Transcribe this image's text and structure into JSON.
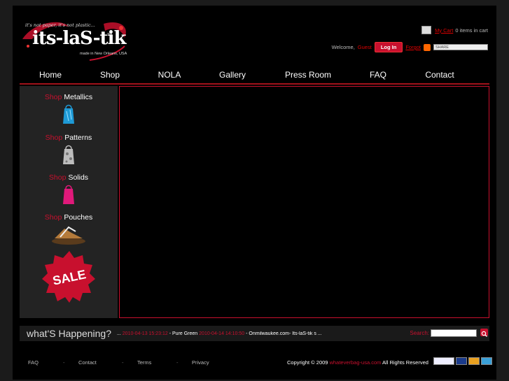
{
  "logo": {
    "tagline": "it's not paper, it's not plastic...",
    "brand": "its-laS-tik",
    "tm": "TM",
    "made_in": "made in New Orleans, USA"
  },
  "header": {
    "cart_link": "My Cart",
    "cart_count": "0 items in cart",
    "welcome": "Welcome,",
    "guest": "Guest",
    "login": "Log In",
    "forgot": "Forgot",
    "share": "SHARE"
  },
  "nav": [
    {
      "label": "Home"
    },
    {
      "label": "Shop"
    },
    {
      "label": "NOLA"
    },
    {
      "label": "Gallery"
    },
    {
      "label": "Press Room"
    },
    {
      "label": "FAQ"
    },
    {
      "label": "Contact"
    }
  ],
  "sidebar": {
    "shop_word": "Shop",
    "items": [
      {
        "label": "Metallics",
        "color": "#1e9ad6"
      },
      {
        "label": "Patterns",
        "color": "#bdbdbd"
      },
      {
        "label": "Solids",
        "color": "#e0197a"
      },
      {
        "label": "Pouches",
        "color": "#b47a3a"
      }
    ],
    "sale": "SALE"
  },
  "happening": {
    "title": "what'S Happening?",
    "lead": "...",
    "date1": "2010-04-13 15:23:12",
    "text1": "- Pure Green",
    "date2": "2010-04-14 14:10:50",
    "text2": "- Onmilwaukee.com- Its-laS-tik s ..."
  },
  "search": {
    "label": "Search:"
  },
  "footer": {
    "links": [
      "FAQ",
      "Contact",
      "Terms",
      "Privacy"
    ],
    "sep": "-",
    "copyright": "Copyright © 2009",
    "site": "whateverbag-usa.com",
    "rights": "All Rights Reserved"
  },
  "colors": {
    "accent": "#c8102e",
    "background": "#000000"
  }
}
